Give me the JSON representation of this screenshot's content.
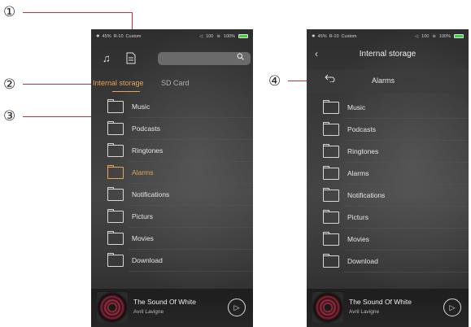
{
  "callouts": {
    "one": "①",
    "two": "②",
    "three": "③",
    "four": "④"
  },
  "status": {
    "brightness": "45%",
    "mode": "R-10",
    "preset": "Custom",
    "volume": "100",
    "battery": "100%"
  },
  "toolbar": {
    "music_icon": "music-note-icon",
    "file_icon": "file-icon",
    "search_icon": "search-icon"
  },
  "tabs": {
    "internal": "Internal storage",
    "sd": "SD Card"
  },
  "folders": [
    {
      "label": "Music",
      "active": false
    },
    {
      "label": "Podcasts",
      "active": false
    },
    {
      "label": "Ringtones",
      "active": false
    },
    {
      "label": "Alarms",
      "active": true
    },
    {
      "label": "Notifications",
      "active": false
    },
    {
      "label": "Picturs",
      "active": false
    },
    {
      "label": "Movies",
      "active": false
    },
    {
      "label": "Download",
      "active": false
    }
  ],
  "right": {
    "title": "Internal storage",
    "subfolder": "Alarms"
  },
  "player": {
    "song": "The Sound Of White",
    "artist": "Avril Lavigne"
  },
  "glyphs": {
    "back": "‹",
    "up": "⮌",
    "play": "▷",
    "search": "⌕"
  },
  "colors": {
    "accent": "#e4a556",
    "callout": "#d42a2a",
    "battery": "#3ad13a"
  }
}
